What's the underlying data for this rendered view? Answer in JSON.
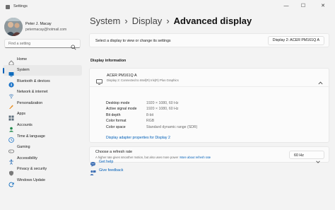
{
  "window": {
    "title": "Settings",
    "minimize_glyph": "—",
    "maximize_glyph": "☐",
    "close_glyph": "✕"
  },
  "profile": {
    "name": "Peter J. Macay",
    "email": "petermacay@hotmail.com"
  },
  "search": {
    "placeholder": "Find a setting",
    "icon": "search-icon"
  },
  "nav": {
    "items": [
      {
        "label": "Home",
        "icon": "home-icon",
        "color": "#6b6b6b",
        "active": false
      },
      {
        "label": "System",
        "icon": "system-icon",
        "color": "#0f6cbd",
        "active": true
      },
      {
        "label": "Bluetooth & devices",
        "icon": "bluetooth-icon",
        "color": "#1a73c8",
        "active": false
      },
      {
        "label": "Network & internet",
        "icon": "network-icon",
        "color": "#2b6fb6",
        "active": false
      },
      {
        "label": "Personalization",
        "icon": "personalization-icon",
        "color": "#e8912a",
        "active": false
      },
      {
        "label": "Apps",
        "icon": "apps-icon",
        "color": "#5a6b7a",
        "active": false
      },
      {
        "label": "Accounts",
        "icon": "accounts-icon",
        "color": "#1f8a4c",
        "active": false
      },
      {
        "label": "Time & language",
        "icon": "time-language-icon",
        "color": "#1a73c8",
        "active": false
      },
      {
        "label": "Gaming",
        "icon": "gaming-icon",
        "color": "#6b6b6b",
        "active": false
      },
      {
        "label": "Accessibility",
        "icon": "accessibility-icon",
        "color": "#2b6fb6",
        "active": false
      },
      {
        "label": "Privacy & security",
        "icon": "privacy-shield-icon",
        "color": "#6b6b6b",
        "active": false
      },
      {
        "label": "Windows Update",
        "icon": "windows-update-icon",
        "color": "#0f6cbd",
        "active": false
      }
    ]
  },
  "breadcrumb": {
    "parts": [
      "System",
      "Display"
    ],
    "separator": "›",
    "current": "Advanced display"
  },
  "display_select": {
    "label": "Select a display to view or change its settings",
    "selected": "Display 2: ACER PM161Q A"
  },
  "display_info": {
    "section_title": "Display information",
    "monitor_name": "ACER PM161Q A",
    "monitor_subtitle": "Display 2: Connected to Intel(R) Iris(R) Plus Graphics",
    "rows": [
      {
        "label": "Desktop mode",
        "value": "1920 × 1080, 60 Hz"
      },
      {
        "label": "Active signal mode",
        "value": "1920 × 1080, 60 Hz"
      },
      {
        "label": "Bit depth",
        "value": "8-bit"
      },
      {
        "label": "Color format",
        "value": "RGB"
      },
      {
        "label": "Color space",
        "value": "Standard dynamic range (SDR)"
      }
    ],
    "adapter_link": "Display adapter properties for Display 2"
  },
  "refresh_rate": {
    "title": "Choose a refresh rate",
    "description": "A higher rate gives smoother motion, but also uses more power",
    "more_link": "More about refresh rate",
    "selected": "60 Hz"
  },
  "help": {
    "get_help": "Get help",
    "give_feedback": "Give feedback"
  },
  "colors": {
    "accent": "#005fb8",
    "background": "#f3f3f3",
    "card": "#fbfbfb"
  }
}
